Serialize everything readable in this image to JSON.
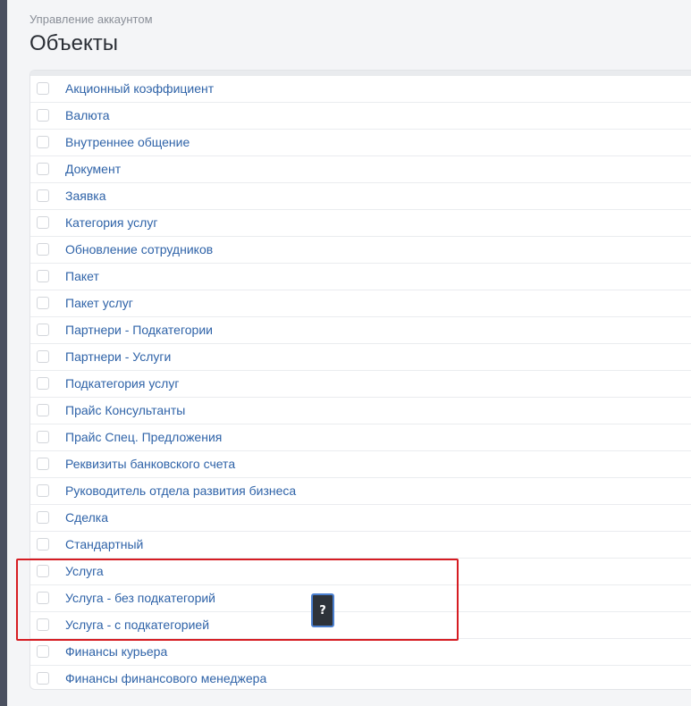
{
  "header": {
    "breadcrumb": "Управление аккаунтом",
    "title": "Объекты"
  },
  "objects": {
    "items": [
      {
        "label": "Акционный коэффициент",
        "checked": false
      },
      {
        "label": "Валюта",
        "checked": false
      },
      {
        "label": "Внутреннее общение",
        "checked": false
      },
      {
        "label": "Документ",
        "checked": false
      },
      {
        "label": "Заявка",
        "checked": false
      },
      {
        "label": "Категория услуг",
        "checked": false
      },
      {
        "label": "Обновление сотрудников",
        "checked": false
      },
      {
        "label": "Пакет",
        "checked": false
      },
      {
        "label": "Пакет услуг",
        "checked": false
      },
      {
        "label": "Партнери - Подкатегории",
        "checked": false
      },
      {
        "label": "Партнери - Услуги",
        "checked": false
      },
      {
        "label": "Подкатегория услуг",
        "checked": false
      },
      {
        "label": "Прайс Консультанты",
        "checked": false
      },
      {
        "label": "Прайс Спец. Предложения",
        "checked": false
      },
      {
        "label": "Реквизиты банковского счета",
        "checked": false
      },
      {
        "label": "Руководитель отдела развития бизнеса",
        "checked": false
      },
      {
        "label": "Сделка",
        "checked": false
      },
      {
        "label": "Стандартный",
        "checked": false
      },
      {
        "label": "Услуга",
        "checked": false
      },
      {
        "label": "Услуга - без подкатегорий",
        "checked": false
      },
      {
        "label": "Услуга - с подкатегорией",
        "checked": false
      },
      {
        "label": "Финансы курьера",
        "checked": false
      },
      {
        "label": "Финансы финансового менеджера",
        "checked": false
      }
    ]
  },
  "help_badge": {
    "label": "?"
  },
  "colors": {
    "link": "#2f63a8",
    "highlight": "#d61c22",
    "badge_bg": "#2e333a",
    "badge_border": "#4a7fcf"
  }
}
